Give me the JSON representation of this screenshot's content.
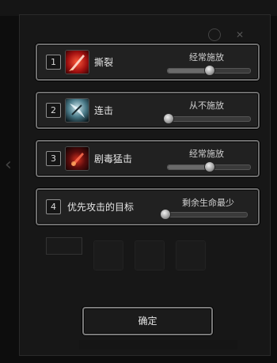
{
  "tactics": [
    {
      "index": "1",
      "name": "撕裂",
      "mode": "经常施放",
      "level": 0.5,
      "icon": "tear-skill-icon"
    },
    {
      "index": "2",
      "name": "连击",
      "mode": "从不施放",
      "level": 0.0,
      "icon": "combo-skill-icon"
    },
    {
      "index": "3",
      "name": "剧毒猛击",
      "mode": "经常施放",
      "level": 0.5,
      "icon": "toxic-strike-skill-icon"
    },
    {
      "index": "4",
      "name": "优先攻击的目标",
      "mode": "剩余生命最少",
      "level": 0.0,
      "icon": ""
    }
  ],
  "confirm_label": "确定",
  "colors": {
    "frame": "#6d6d6d",
    "background": "#0d0d0d",
    "row_bg": "#212121"
  }
}
